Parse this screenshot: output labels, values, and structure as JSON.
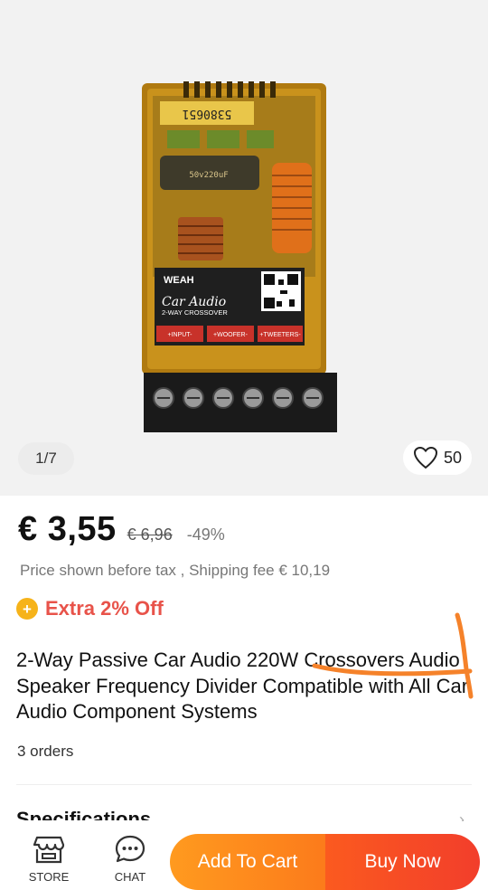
{
  "gallery": {
    "counter": "1/7",
    "wishlist_count": "50",
    "image": {
      "serial": "5380651",
      "brand": "WEAH",
      "product_name": "Car Audio",
      "product_type": "2-WAY CROSSOVER",
      "terminals": [
        "+INPUT-",
        "+WOOFER-",
        "+TWEETERS-"
      ],
      "cap_label": "50v220uF"
    }
  },
  "price": {
    "current": "€ 3,55",
    "original": "€ 6,96",
    "discount": "-49%",
    "tax_note": "Price shown before tax , Shipping fee € 10,19"
  },
  "promo": {
    "icon": "plus-coin-icon",
    "label": "Extra 2% Off",
    "accent": "#e8534a"
  },
  "product": {
    "title": "2-Way Passive Car Audio 220W Crossovers Audio Speaker Frequency Divider Compatible with All Car Audio Component Systems",
    "orders": "3 orders"
  },
  "specs": {
    "label": "Specifications"
  },
  "bottom_bar": {
    "store_label": "STORE",
    "chat_label": "CHAT",
    "add_to_cart": "Add To Cart",
    "buy_now": "Buy Now",
    "cart_color": "#fc8a1d",
    "buy_color": "#f44a26"
  }
}
